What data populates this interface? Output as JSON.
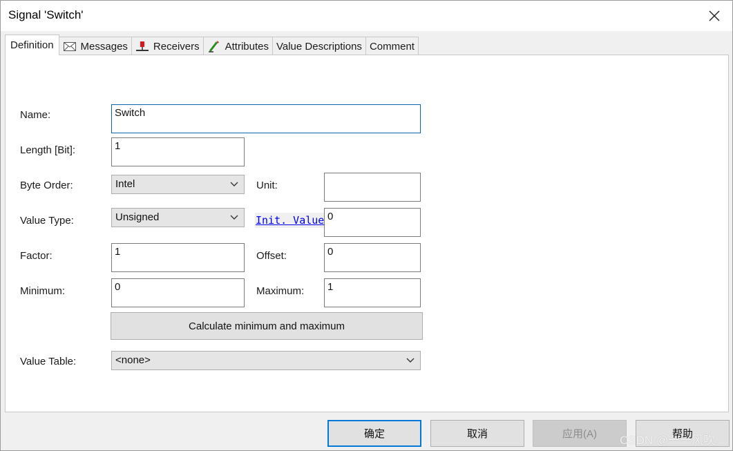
{
  "window": {
    "title": "Signal 'Switch'"
  },
  "tabs": [
    {
      "label": "Definition",
      "icon": "none"
    },
    {
      "label": "Messages",
      "icon": "envelope-icon"
    },
    {
      "label": "Receivers",
      "icon": "receiver-node-icon"
    },
    {
      "label": "Attributes",
      "icon": "pencil-attribute-icon"
    },
    {
      "label": "Value Descriptions",
      "icon": "none"
    },
    {
      "label": "Comment",
      "icon": "none"
    }
  ],
  "form": {
    "name_label": "Name:",
    "name_value": "Switch",
    "length_label": "Length [Bit]:",
    "length_value": "1",
    "byte_order_label": "Byte Order:",
    "byte_order_value": "Intel",
    "unit_label": "Unit:",
    "unit_value": "",
    "value_type_label": "Value Type:",
    "value_type_value": "Unsigned",
    "init_value_label": "Init. Value",
    "init_value": "0",
    "factor_label": "Factor:",
    "factor_value": "1",
    "offset_label": "Offset:",
    "offset_value": "0",
    "minimum_label": "Minimum:",
    "minimum_value": "0",
    "maximum_label": "Maximum:",
    "maximum_value": "1",
    "calc_button_label": "Calculate minimum and maximum",
    "value_table_label": "Value Table:",
    "value_table_value": "<none>"
  },
  "buttons": {
    "ok": "确定",
    "cancel": "取消",
    "apply": "应用(A)",
    "help": "帮助"
  },
  "watermark": "CSDN @一一风吹",
  "colors": {
    "focus_border": "#0a64ad",
    "default_button_border": "#0078d7",
    "link": "#0000ee"
  }
}
